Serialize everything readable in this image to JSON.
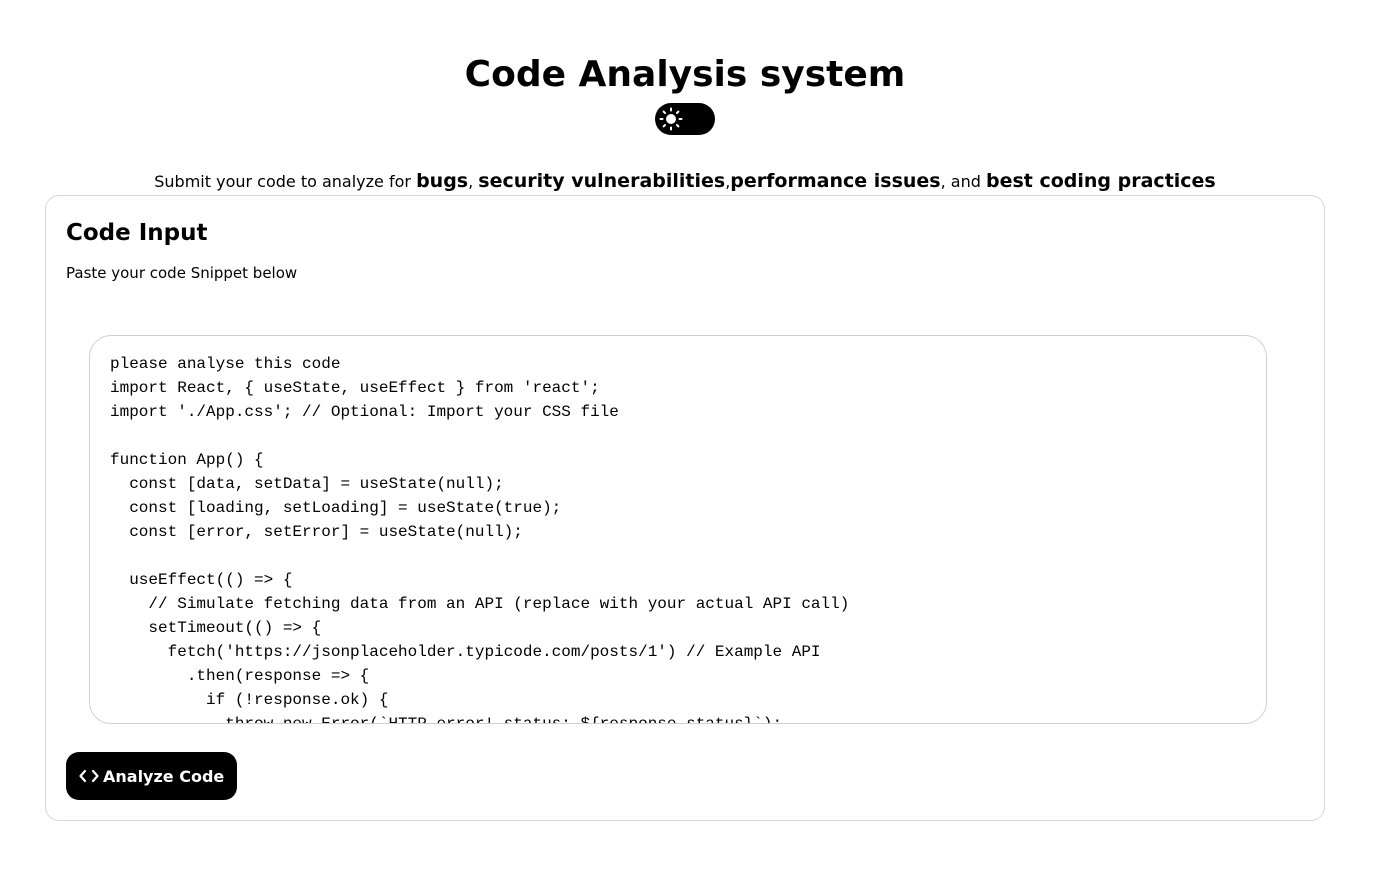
{
  "header": {
    "title": "Code Analysis system",
    "theme_toggle_icon": "sun-icon"
  },
  "subtitle": {
    "prefix": "Submit your code to analyze for ",
    "bugs": "bugs",
    "sep1": ", ",
    "security": "security vulnerabilities",
    "sep2": ",",
    "performance": "performance issues",
    "sep3": ", and ",
    "practices": "best coding practices"
  },
  "card": {
    "title": "Code Input",
    "description": "Paste your code Snippet below",
    "code_value": "please analyse this code\nimport React, { useState, useEffect } from 'react';\nimport './App.css'; // Optional: Import your CSS file\n\nfunction App() {\n  const [data, setData] = useState(null);\n  const [loading, setLoading] = useState(true);\n  const [error, setError] = useState(null);\n\n  useEffect(() => {\n    // Simulate fetching data from an API (replace with your actual API call)\n    setTimeout(() => {\n      fetch('https://jsonplaceholder.typicode.com/posts/1') // Example API\n        .then(response => {\n          if (!response.ok) {\n            throw new Error(`HTTP error! status: ${response.status}`);",
    "analyze_button_label": "Analyze Code",
    "analyze_button_icon": "code-brackets-icon"
  }
}
